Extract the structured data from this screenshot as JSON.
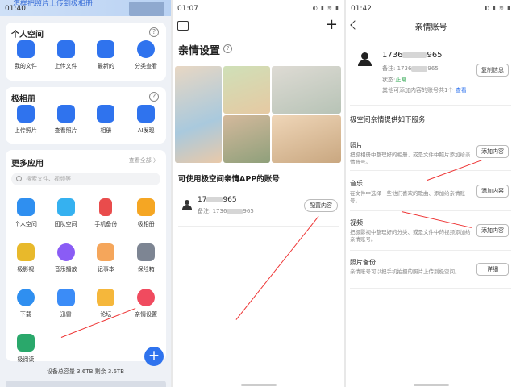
{
  "screen1": {
    "status_time": "01:40",
    "banner_text": "怎样把照片上传到极相册",
    "personal_space": {
      "title": "个人空间",
      "help": "?",
      "items": [
        {
          "label": "我的文件",
          "icon": "file-icon",
          "color": "#2f73ee"
        },
        {
          "label": "上传文件",
          "icon": "upload-icon",
          "color": "#2f73ee"
        },
        {
          "label": "最新的",
          "icon": "recent-icon",
          "color": "#2f73ee"
        },
        {
          "label": "分类查看",
          "icon": "category-icon",
          "color": "#2f73ee"
        }
      ]
    },
    "album": {
      "title": "极相册",
      "help": "?",
      "items": [
        {
          "label": "上传照片",
          "icon": "upload-photo-icon",
          "color": "#2f73ee"
        },
        {
          "label": "查看照片",
          "icon": "view-photo-icon",
          "color": "#2f73ee"
        },
        {
          "label": "相册",
          "icon": "album-icon",
          "color": "#2f73ee"
        },
        {
          "label": "AI发现",
          "icon": "ai-discover-icon",
          "color": "#2f73ee"
        }
      ]
    },
    "more_apps": {
      "title": "更多应用",
      "more_link": "查看全部 〉",
      "search_placeholder": "搜索文件、视频等",
      "rows": [
        [
          {
            "label": "个人空间",
            "icon": "personal-space-icon",
            "color": "#2f8ff0"
          },
          {
            "label": "团队空间",
            "icon": "team-space-icon",
            "color": "#35b1f0"
          },
          {
            "label": "手机备份",
            "icon": "phone-backup-icon",
            "color": "#e94c4c"
          },
          {
            "label": "极相册",
            "icon": "album-app-icon",
            "color": "#f5a623"
          }
        ],
        [
          {
            "label": "极影视",
            "icon": "video-icon",
            "color": "#e8b92b"
          },
          {
            "label": "音乐播放",
            "icon": "music-icon",
            "color": "#8a5cf5"
          },
          {
            "label": "记事本",
            "icon": "notepad-icon",
            "color": "#f5a65b"
          },
          {
            "label": "保险箱",
            "icon": "safe-icon",
            "color": "#7d8593"
          }
        ],
        [
          {
            "label": "下载",
            "icon": "download-icon",
            "color": "#2f8ff0"
          },
          {
            "label": "迅雷",
            "icon": "xunlei-icon",
            "color": "#3b8cf7"
          },
          {
            "label": "论坛",
            "icon": "forum-icon",
            "color": "#f5b73b"
          },
          {
            "label": "亲情设置",
            "icon": "family-settings-icon",
            "color": "#f04b5f"
          }
        ],
        [
          {
            "label": "极阅读",
            "icon": "reader-icon",
            "color": "#2aa86b"
          }
        ]
      ]
    },
    "fab": "+",
    "capacity_text": "设备总容量 3.6TB  剩余 3.6TB"
  },
  "screen2": {
    "status_time": "01:07",
    "status_icons": "◐ ▮ ≋ ▮",
    "plus": "+",
    "title": "亲情设置",
    "help": "?",
    "subtitle": "可使用极空间亲情APP的账号",
    "account": {
      "name_prefix": "17",
      "name_suffix": "965",
      "note_prefix": "备注: 1736",
      "note_suffix": "965",
      "button": "配置内容"
    }
  },
  "screen3": {
    "status_time": "01:42",
    "status_icons": "◐ ▮ ≋ ▮",
    "title": "亲情账号",
    "account": {
      "name_prefix": "1736",
      "name_suffix": "965",
      "note_prefix": "备注: 1736",
      "note_suffix": "965",
      "status_label": "状态:",
      "status_value": "正常",
      "other_text": "其他可添加内容的账号共1个",
      "view_link": "查看",
      "copy_button": "复制信息",
      "status_color": "#27a34a",
      "link_color": "#2f73ee"
    },
    "section_head": "极空间亲情提供如下服务",
    "services": [
      {
        "title": "照片",
        "desc": "把极相册中整理好的相册、或是文件中照片添加给亲情账号。",
        "button": "添加内容"
      },
      {
        "title": "音乐",
        "desc": "在文件中选择一些他们喜欢的歌曲、添加给亲情账号。",
        "button": "添加内容"
      },
      {
        "title": "视频",
        "desc": "把极影视中整理好的分类、或是文件中的视频添加给亲情账号。",
        "button": "添加内容"
      },
      {
        "title": "照片备份",
        "desc": "亲情账号可以把手机拍摄的照片上传到极空间。",
        "button": "详细"
      }
    ]
  }
}
